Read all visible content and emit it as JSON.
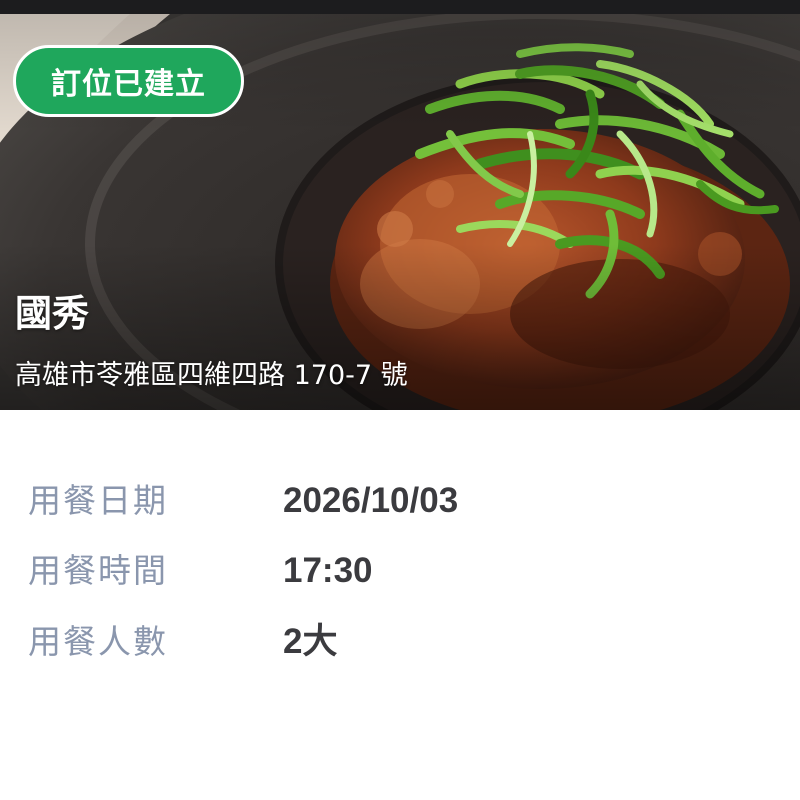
{
  "status_badge": {
    "label": "訂位已建立",
    "color": "#1fa75c"
  },
  "restaurant": {
    "name": "國秀",
    "address": "高雄市苓雅區四維四路 170-7 號"
  },
  "reservation": {
    "date_label": "用餐日期",
    "date_value": "2026/10/03",
    "time_label": "用餐時間",
    "time_value": "17:30",
    "party_label": "用餐人數",
    "party_value": "2大"
  }
}
